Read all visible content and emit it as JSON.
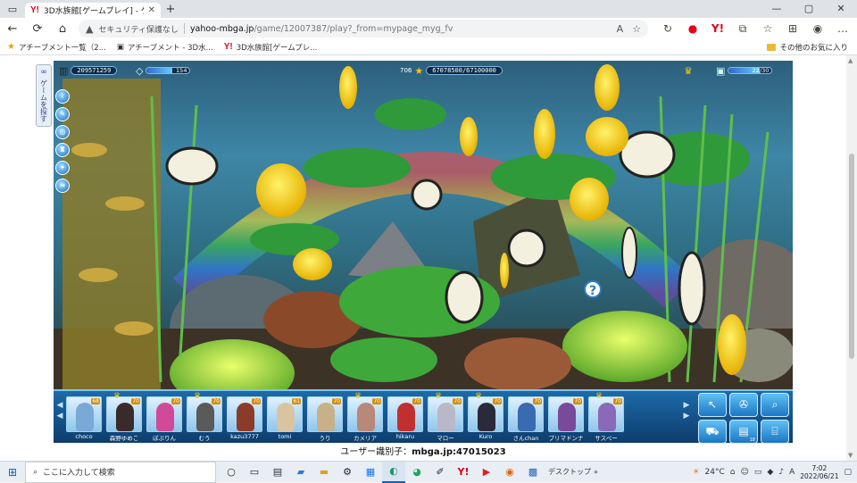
{
  "browser": {
    "tab_title": "3D水族館[ゲームプレイ] - ゲームなら",
    "url_warning": "セキュリティ保護なし",
    "url_host": "yahoo-mbga.jp",
    "url_path": "/game/12007387/play?_from=mypage_myg_fv",
    "bookmarks": [
      "アチーブメント一覧（2...",
      "アチーブメント - 3D水...",
      "3D水族館[ゲームプレ..."
    ],
    "other_favorites": "その他のお気に入り"
  },
  "side_tab": {
    "label": "ゲームを探す"
  },
  "hud": {
    "coins": "209571259",
    "gems": "154",
    "level": "706",
    "exp": "67078500/67100000",
    "gauge": "22/30",
    "gem_fill": 0.6,
    "exp_fill": 0.99,
    "gauge_fill": 0.73
  },
  "friends": [
    {
      "name": "choco",
      "level": "68",
      "crown": false,
      "color": "#7aa9d8"
    },
    {
      "name": "森野ゆめこ",
      "level": "70",
      "crown": true,
      "color": "#3a2a2a"
    },
    {
      "name": "ぽぷりん",
      "level": "70",
      "crown": false,
      "color": "#d04a9a"
    },
    {
      "name": "むう",
      "level": "70",
      "crown": true,
      "color": "#5a5a5a"
    },
    {
      "name": "kazu3777",
      "level": "70",
      "crown": false,
      "color": "#8b3b2a"
    },
    {
      "name": "tomi",
      "level": "61",
      "crown": false,
      "color": "#d8c4a0"
    },
    {
      "name": "うり",
      "level": "70",
      "crown": false,
      "color": "#c8b088"
    },
    {
      "name": "カメリア",
      "level": "70",
      "crown": true,
      "color": "#b88878"
    },
    {
      "name": "hikaru",
      "level": "70",
      "crown": false,
      "color": "#c03030"
    },
    {
      "name": "マロー",
      "level": "70",
      "crown": true,
      "color": "#b8b8c8"
    },
    {
      "name": "Kuro",
      "level": "70",
      "crown": true,
      "color": "#2a2a3a"
    },
    {
      "name": "さんchan",
      "level": "70",
      "crown": false,
      "color": "#3a6ab0"
    },
    {
      "name": "プリマドンナ",
      "level": "70",
      "crown": false,
      "color": "#7a4a9a"
    },
    {
      "name": "サスペー",
      "level": "70",
      "crown": true,
      "color": "#8a6ab8"
    }
  ],
  "actions": [
    {
      "name": "cursor",
      "glyph": "↖",
      "badge": ""
    },
    {
      "name": "film",
      "glyph": "✇",
      "badge": ""
    },
    {
      "name": "magnifier",
      "glyph": "⌕",
      "badge": ""
    },
    {
      "name": "cart",
      "glyph": "⛟",
      "badge": ""
    },
    {
      "name": "book",
      "glyph": "▤",
      "badge": "18"
    },
    {
      "name": "gift",
      "glyph": "⌸",
      "badge": ""
    }
  ],
  "user_id": {
    "label": "ユーザー識別子：",
    "value": "mbga.jp:47015023"
  },
  "taskbar": {
    "search_placeholder": "ここに入力して検索",
    "desktop_label": "デスクトップ",
    "temperature": "24°C",
    "time": "7:02",
    "date": "2022/06/21"
  }
}
